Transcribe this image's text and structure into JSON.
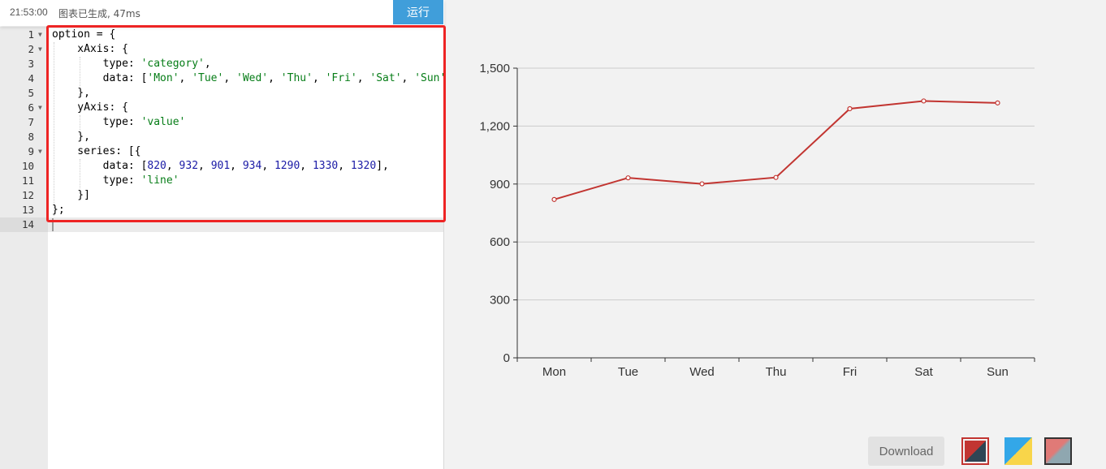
{
  "status": {
    "time": "21:53:00",
    "message": "图表已生成, 47ms"
  },
  "toolbar": {
    "run_label": "运行",
    "download_label": "Download"
  },
  "editor": {
    "lines": [
      {
        "num": "1",
        "fold": true,
        "html": "option = {"
      },
      {
        "num": "2",
        "fold": true,
        "html": "    xAxis: {"
      },
      {
        "num": "3",
        "fold": false,
        "html": "        type: <span class=\"str\">'category'</span>,"
      },
      {
        "num": "4",
        "fold": false,
        "html": "        data: [<span class=\"str\">'Mon'</span>, <span class=\"str\">'Tue'</span>, <span class=\"str\">'Wed'</span>, <span class=\"str\">'Thu'</span>, <span class=\"str\">'Fri'</span>, <span class=\"str\">'Sat'</span>, <span class=\"str\">'Sun'</span>]"
      },
      {
        "num": "5",
        "fold": false,
        "html": "    },"
      },
      {
        "num": "6",
        "fold": true,
        "html": "    yAxis: {"
      },
      {
        "num": "7",
        "fold": false,
        "html": "        type: <span class=\"str\">'value'</span>"
      },
      {
        "num": "8",
        "fold": false,
        "html": "    },"
      },
      {
        "num": "9",
        "fold": true,
        "html": "    series: [{"
      },
      {
        "num": "10",
        "fold": false,
        "html": "        data: [<span class=\"num\">820</span>, <span class=\"num\">932</span>, <span class=\"num\">901</span>, <span class=\"num\">934</span>, <span class=\"num\">1290</span>, <span class=\"num\">1330</span>, <span class=\"num\">1320</span>],"
      },
      {
        "num": "11",
        "fold": false,
        "html": "        type: <span class=\"str\">'line'</span>"
      },
      {
        "num": "12",
        "fold": false,
        "html": "    }]"
      },
      {
        "num": "13",
        "fold": false,
        "html": "};"
      },
      {
        "num": "14",
        "fold": false,
        "html": ""
      }
    ]
  },
  "colors": {
    "series": "#c23531",
    "highlight": "#ee2424",
    "run_button": "#409eda"
  },
  "chart_data": {
    "type": "line",
    "categories": [
      "Mon",
      "Tue",
      "Wed",
      "Thu",
      "Fri",
      "Sat",
      "Sun"
    ],
    "series": [
      {
        "values": [
          820,
          932,
          901,
          934,
          1290,
          1330,
          1320
        ]
      }
    ],
    "yticks": [
      0,
      300,
      600,
      900,
      1200,
      1500
    ],
    "ytick_labels": [
      "0",
      "300",
      "600",
      "900",
      "1,200",
      "1,500"
    ],
    "ylim": [
      0,
      1500
    ],
    "grid": true,
    "title": "",
    "xlabel": "",
    "ylabel": ""
  }
}
